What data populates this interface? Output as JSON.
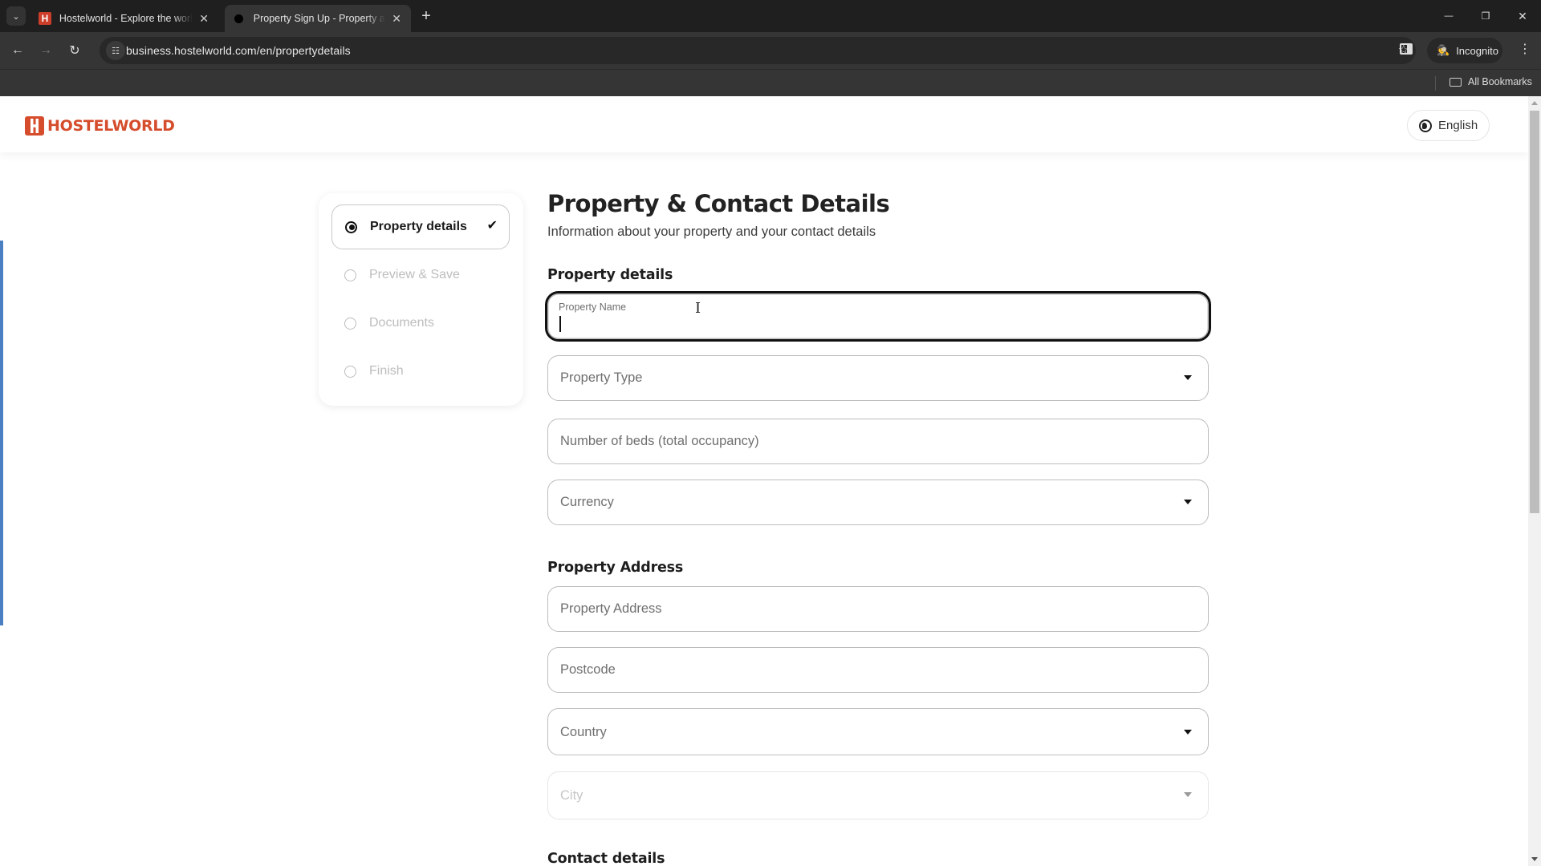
{
  "browser": {
    "tabs": [
      {
        "title": "Hostelworld - Explore the world",
        "favicon": "hostelworld-h-icon",
        "active": false
      },
      {
        "title": "Property Sign Up - Property and Contact Details",
        "favicon": "loading-dot-icon",
        "active": true
      }
    ],
    "url": "business.hostelworld.com/en/propertydetails",
    "profile_label": "Incognito",
    "bookmarks_label": "All Bookmarks",
    "icons": {
      "tab_list": "chevron-down-icon",
      "new_tab": "plus-icon",
      "back": "arrow-left-icon",
      "forward": "arrow-right-icon",
      "reload": "reload-icon",
      "site_info": "tune-icon",
      "bookmark": "star-icon",
      "side_panel": "side-panel-icon",
      "incognito": "incognito-icon",
      "menu": "kebab-menu-icon",
      "minimize": "minimize-icon",
      "maximize": "restore-icon",
      "close": "close-icon",
      "folder": "folder-icon"
    },
    "glyphs": {
      "tab_list": "⌄",
      "tab_close": "✕",
      "new_tab": "+",
      "back": "←",
      "forward": "→",
      "reload": "↻",
      "site_info": "☷",
      "star": "☆",
      "incognito": "🕵",
      "menu": "⋮",
      "minimize": "—",
      "maximize": "❐",
      "close": "✕",
      "favicon_h": "H"
    }
  },
  "site": {
    "brand": "HOSTELWORLD",
    "brand_color": "#d54d2c",
    "language_label": "English",
    "accent_color": "#4a7fc1"
  },
  "steps": [
    {
      "label": "Property details",
      "state": "current",
      "completed_mark": "✔"
    },
    {
      "label": "Preview & Save",
      "state": "pending"
    },
    {
      "label": "Documents",
      "state": "pending"
    },
    {
      "label": "Finish",
      "state": "pending"
    }
  ],
  "form": {
    "title": "Property & Contact Details",
    "subtitle": "Information about your property and your contact details",
    "sections": {
      "property_details": "Property details",
      "property_address": "Property Address",
      "contact_details": "Contact details"
    },
    "fields": {
      "property_name": {
        "label": "Property Name",
        "value": "",
        "focused": true
      },
      "property_type": {
        "placeholder": "Property Type",
        "type": "select"
      },
      "beds": {
        "placeholder": "Number of beds (total occupancy)"
      },
      "currency": {
        "placeholder": "Currency",
        "type": "select"
      },
      "address": {
        "placeholder": "Property Address"
      },
      "postcode": {
        "placeholder": "Postcode"
      },
      "country": {
        "placeholder": "Country",
        "type": "select"
      },
      "city": {
        "placeholder": "City",
        "type": "select",
        "disabled": true
      }
    }
  }
}
